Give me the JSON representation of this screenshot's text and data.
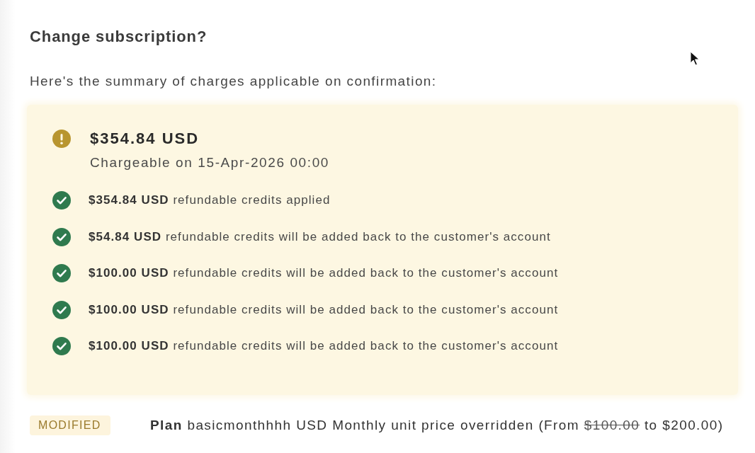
{
  "dialog": {
    "title": "Change subscription?",
    "intro": "Here's the summary of charges applicable on confirmation:"
  },
  "summary": {
    "amount": "$354.84 USD",
    "note": "Chargeable on 15-Apr-2026 00:00",
    "items": [
      {
        "text": "**$354.84 USD** refundable credits applied"
      },
      {
        "text": "**$54.84 USD** refundable credits will be added back to the customer's account"
      },
      {
        "text": "**$100.00 USD** refundable credits will be added back to the customer's account"
      },
      {
        "text": "**$100.00 USD** refundable credits will be added back to the customer's account"
      },
      {
        "text": "**$100.00 USD** refundable credits will be added back to the customer's account"
      }
    ]
  },
  "changes": [
    {
      "badge": "MODIFIED",
      "text": "**Plan** basicmonthhhh USD Monthly unit price overridden (From",
      "old_value": "$100.00",
      "text_after": "to $200.00)"
    }
  ]
}
